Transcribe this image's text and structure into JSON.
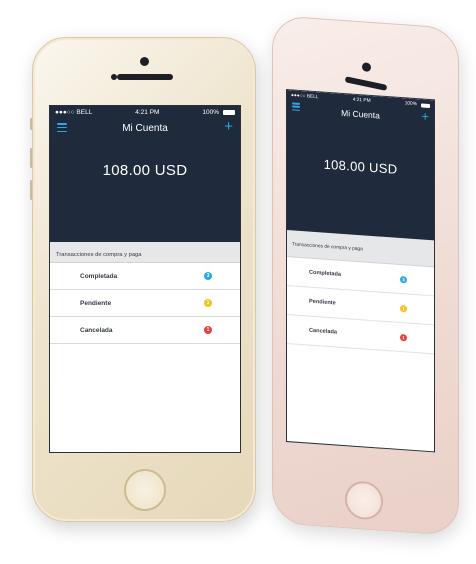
{
  "status": {
    "carrier": "●●●○○ BELL",
    "time": "4:21 PM",
    "battery": "100%"
  },
  "nav": {
    "title": "Mi Cuenta"
  },
  "account": {
    "balance": "108.00 USD"
  },
  "transactions": {
    "section_label": "Transacciones de compra y paga",
    "items": [
      {
        "label": "Completada",
        "count": "3"
      },
      {
        "label": "Pendiente",
        "count": "1"
      },
      {
        "label": "Cancelada",
        "count": "1"
      }
    ]
  },
  "colors": {
    "header_bg": "#1f2a3c",
    "accent": "#29a9e0",
    "completed": "#29a9e0",
    "pending": "#f4c21c",
    "cancelled": "#e8403b"
  }
}
